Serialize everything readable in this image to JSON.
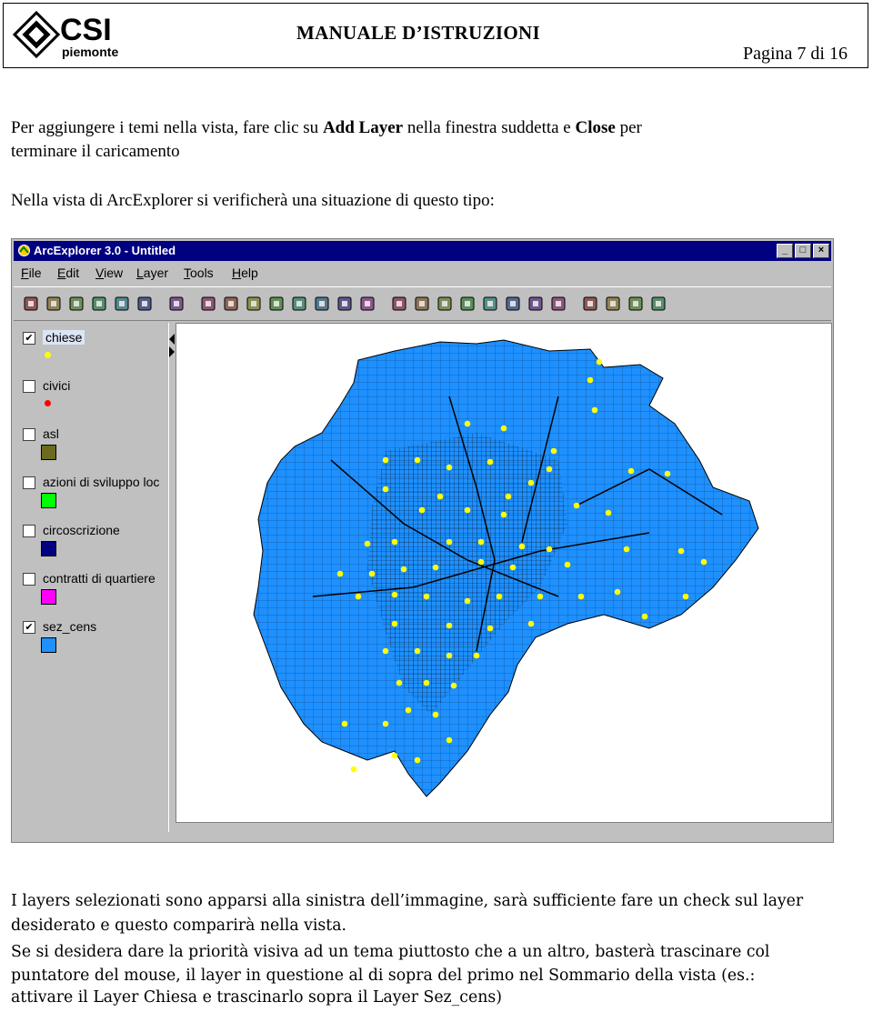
{
  "header": {
    "logo_text": "CSI",
    "logo_subtext": "piemonte",
    "title": "MANUALE D’ISTRUZIONI",
    "page": "Pagina 7 di 16"
  },
  "intro": {
    "line1_pre": "Per aggiungere i temi nella vista, fare clic su ",
    "add_layer": "Add Layer",
    "line1_mid": " nella finestra suddetta e ",
    "close": "Close",
    "line1_post": " per",
    "line2": "terminare il caricamento",
    "line3": "Nella vista di ArcExplorer si verificherà una situazione di questo tipo:"
  },
  "window": {
    "title": "ArcExplorer 3.0 - Untitled",
    "controls": [
      "_",
      "□",
      "×"
    ],
    "menu": [
      "File",
      "Edit",
      "View",
      "Layer",
      "Tools",
      "Help"
    ],
    "toolbar_icons": [
      "open-icon",
      "save-icon",
      "open-project-icon",
      "save-project-icon",
      "add-layer-icon",
      "print-icon",
      "stop-icon",
      "pan-back-icon",
      "zoom-previous-icon",
      "zoom-full-icon",
      "zoom-active-icon",
      "zoom-in-icon",
      "zoom-out-icon",
      "pan-icon",
      "pan-realtime-icon",
      "identify-icon",
      "select-icon",
      "find-icon",
      "query-icon",
      "query-builder-icon",
      "spatial-query-icon",
      "attributes-icon",
      "properties-icon",
      "clear-icon",
      "locate-icon",
      "grid-icon",
      "table-icon"
    ]
  },
  "legend": [
    {
      "name": "chiese",
      "checked": true,
      "symbol": "dot",
      "color": "#ffff00"
    },
    {
      "name": "civici",
      "checked": false,
      "symbol": "dot",
      "color": "#ff0000"
    },
    {
      "name": "asl",
      "checked": false,
      "symbol": "square",
      "color": "#6b6b1e"
    },
    {
      "name": "azioni di sviluppo loc",
      "checked": false,
      "symbol": "square",
      "color": "#00ff00"
    },
    {
      "name": "circoscrizione",
      "checked": false,
      "symbol": "square",
      "color": "#000080"
    },
    {
      "name": "contratti di quartiere",
      "checked": false,
      "symbol": "square",
      "color": "#ff00ff"
    },
    {
      "name": "sez_cens",
      "checked": true,
      "symbol": "square",
      "color": "#1e90ff"
    }
  ],
  "body": {
    "p1": "I layers selezionati sono apparsi alla sinistra dell’immagine, sarà sufficiente fare un check sul layer",
    "p2": "desiderato e questo comparirà nella vista.",
    "p3": "Se si desidera dare la priorità visiva ad un tema piuttosto che a un altro, basterà trascinare col",
    "p4": "puntatore del mouse, il layer in questione al di sopra del primo nel Sommario della vista (es.:",
    "p5": "attivare il Layer Chiesa e trascinarlo sopra il Layer Sez_cens)"
  },
  "colors": {
    "title_bar": "#000080",
    "map_fill": "#1e90ff",
    "points": "#ffff00"
  }
}
